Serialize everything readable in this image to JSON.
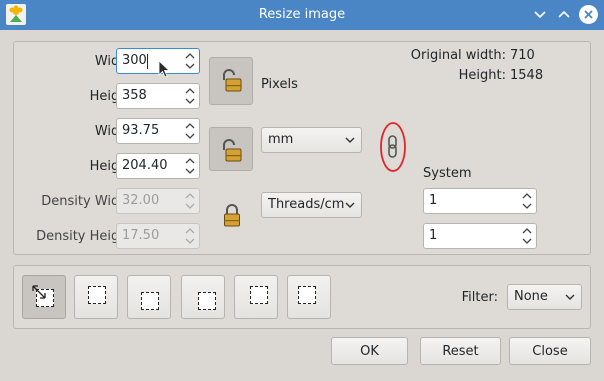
{
  "window": {
    "title": "Resize image"
  },
  "pixels": {
    "width_label": "Width:",
    "width_value": "300",
    "height_label": "Height:",
    "height_value": "358",
    "unit_label": "Pixels"
  },
  "physical": {
    "width_label": "Width:",
    "width_value": "93.75",
    "height_label": "Height:",
    "height_value": "204.40",
    "unit": "mm"
  },
  "density": {
    "width_label": "Density Width:",
    "width_value": "32.00",
    "height_label": "Density Height:",
    "height_value": "17.50",
    "unit": "Threads/cm"
  },
  "original": {
    "width_label": "Original width:",
    "width_value": "710",
    "height_label": "Height:",
    "height_value": "1548"
  },
  "system": {
    "label": "System",
    "value1": "1",
    "value2": "1"
  },
  "filter": {
    "label": "Filter:",
    "value": "None"
  },
  "buttons": {
    "ok": "OK",
    "reset": "Reset",
    "close": "Close"
  },
  "icons": {
    "lock_pixels": "unlocked-padlock-icon",
    "lock_physical": "unlocked-padlock-icon",
    "lock_density": "locked-padlock-icon",
    "chain": "chain-link-icon"
  },
  "colors": {
    "titlebar": "#4a85c5",
    "highlight_circle": "#e0242a",
    "focus_border": "#3b89d9"
  }
}
